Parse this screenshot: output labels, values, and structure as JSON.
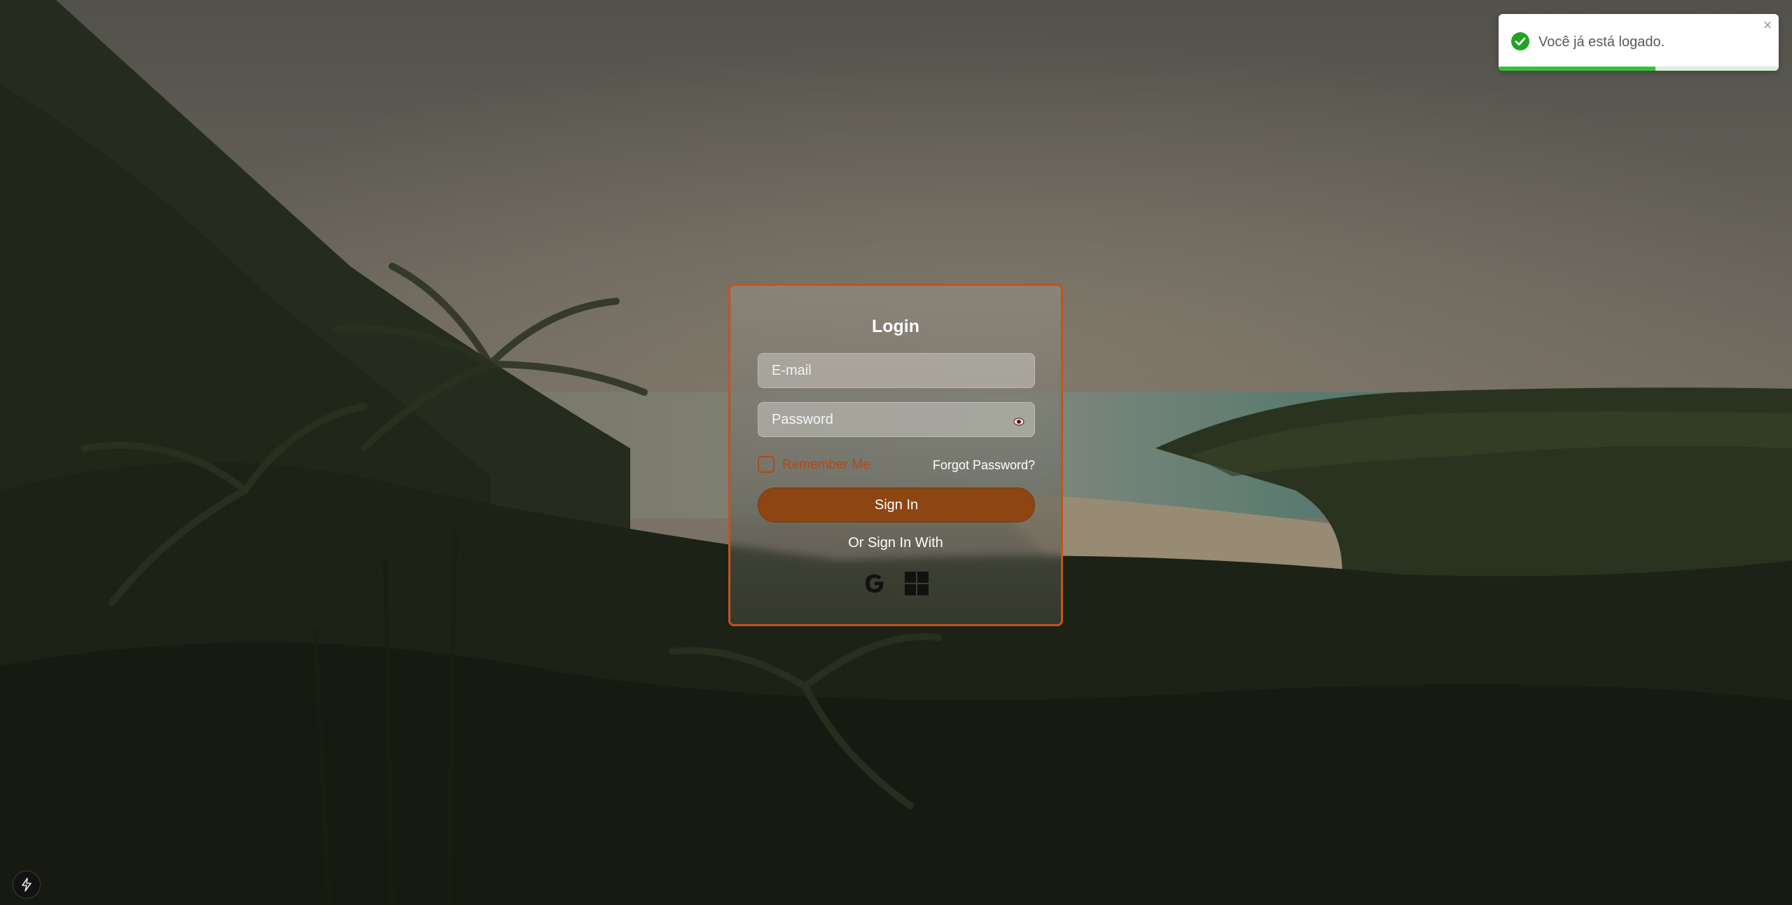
{
  "login": {
    "title": "Login",
    "email_placeholder": "E-mail",
    "password_placeholder": "Password",
    "remember_label": "Remember Me",
    "forgot_label": "Forgot Password?",
    "signin_label": "Sign In",
    "or_label": "Or Sign In With",
    "social": [
      {
        "icon": "google-icon"
      },
      {
        "icon": "windows-icon"
      }
    ]
  },
  "toast": {
    "message": "Você já está logado.",
    "icon": "check-circle-icon",
    "close": "×",
    "progress": 0.56,
    "color": "#34c236"
  },
  "colors": {
    "accent": "#c4531c",
    "button": "#8c4513",
    "remember": "#b24a16"
  },
  "badge": {
    "icon": "lightning-icon"
  }
}
